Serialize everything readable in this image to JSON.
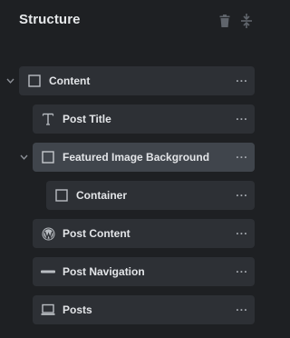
{
  "panel": {
    "title": "Structure",
    "header_icons": [
      "trash-icon",
      "collapse-all-icon"
    ]
  },
  "tree": [
    {
      "label": "Content",
      "icon": "square-container-icon",
      "depth": 0,
      "expanded": true,
      "selected": false
    },
    {
      "label": "Post Title",
      "icon": "text-t-icon",
      "depth": 1,
      "expanded": null,
      "selected": false
    },
    {
      "label": "Featured Image Background",
      "icon": "square-container-icon",
      "depth": 1,
      "expanded": true,
      "selected": true
    },
    {
      "label": "Container",
      "icon": "square-container-icon",
      "depth": 2,
      "expanded": null,
      "selected": false
    },
    {
      "label": "Post Content",
      "icon": "wordpress-icon",
      "depth": 1,
      "expanded": null,
      "selected": false
    },
    {
      "label": "Post Navigation",
      "icon": "horizontal-line-icon",
      "depth": 1,
      "expanded": null,
      "selected": false
    },
    {
      "label": "Posts",
      "icon": "laptop-icon",
      "depth": 1,
      "expanded": null,
      "selected": false
    }
  ],
  "more_label": "···",
  "colors": {
    "background": "#1e2023",
    "row": "#2d3035",
    "row_selected": "#40454c",
    "text": "#e3e5e8",
    "muted": "#a7abb1"
  }
}
